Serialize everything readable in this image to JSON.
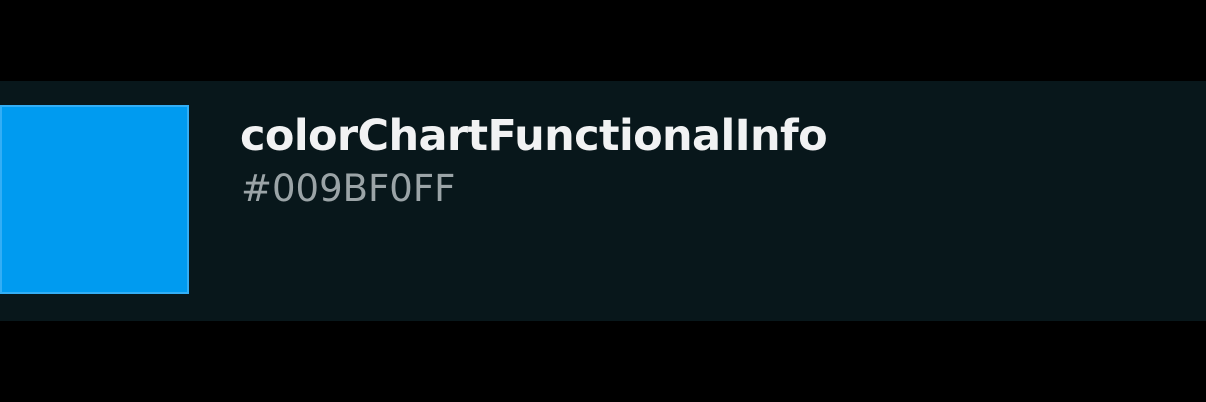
{
  "token": {
    "name": "colorChartFunctionalInfo",
    "value": "#009BF0FF",
    "swatch_color": "#009bf0"
  },
  "colors": {
    "page_background": "#000000",
    "row_background": "#08171b",
    "name_text": "#f1f2f3",
    "value_text": "#9ba4a7"
  }
}
